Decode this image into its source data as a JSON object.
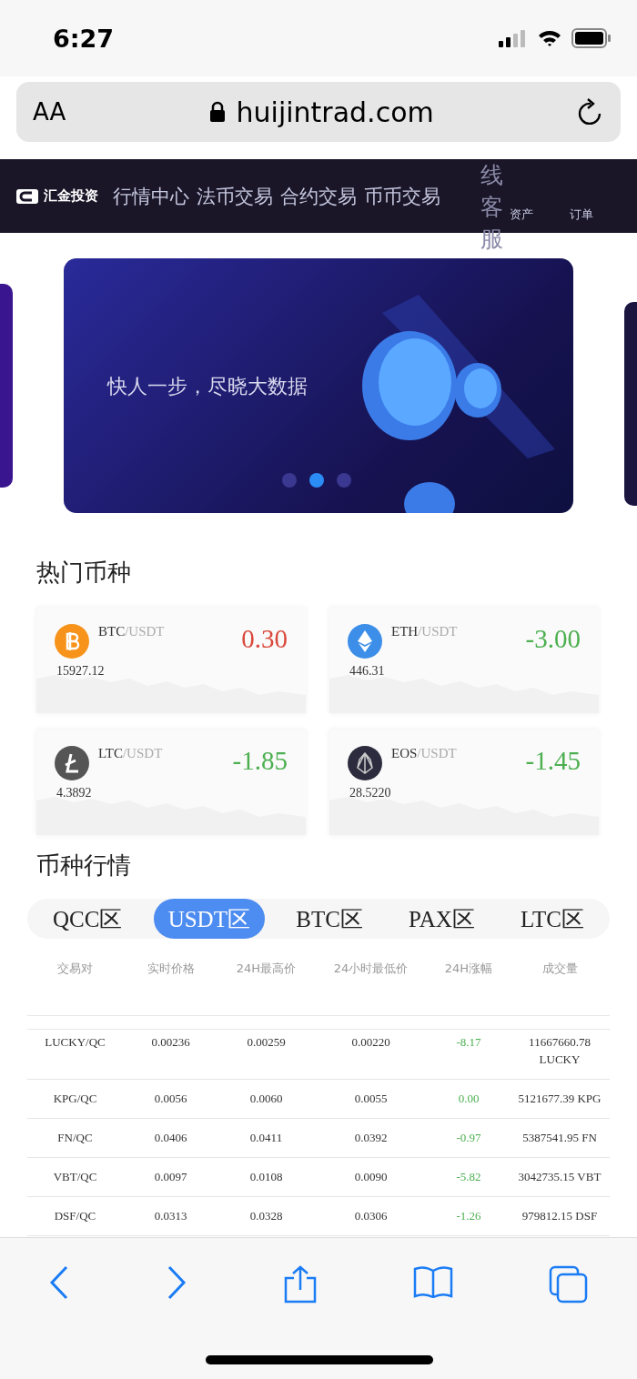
{
  "status_bar": {
    "time": "6:27"
  },
  "url_bar": {
    "text_size": "AA",
    "url": "huijintrad.com"
  },
  "nav": {
    "logo": "汇金投资",
    "items": [
      "行情中心",
      "法币交易",
      "合约交易",
      "币币交易"
    ],
    "service": "线客服",
    "right_items": [
      "资产",
      "订单"
    ]
  },
  "banner": {
    "caption": "快人一步，尽晓大数据",
    "dots": [
      {
        "selected": false
      },
      {
        "selected": true
      },
      {
        "selected": false
      }
    ]
  },
  "hot_title": "热门币种",
  "hot_coins": [
    {
      "kind": "btc",
      "base": "BTC",
      "quote": "/USDT",
      "price": "15927.12",
      "change": "0.30",
      "color": "#d9493c"
    },
    {
      "kind": "eth",
      "base": "ETH",
      "quote": "/USDT",
      "price": "446.31",
      "change": "-3.00",
      "color": "#4caf50"
    },
    {
      "kind": "ltc",
      "base": "LTC",
      "quote": "/USDT",
      "price": "4.3892",
      "change": "-1.85",
      "color": "#4caf50"
    },
    {
      "kind": "eos",
      "base": "EOS",
      "quote": "/USDT",
      "price": "28.5220",
      "change": "-1.45",
      "color": "#4caf50"
    }
  ],
  "market_title": "币种行情",
  "market_tabs": [
    {
      "label": "QCC区",
      "selected": false
    },
    {
      "label": "USDT区",
      "selected": true
    },
    {
      "label": "BTC区",
      "selected": false
    },
    {
      "label": "PAX区",
      "selected": false
    },
    {
      "label": "LTC区",
      "selected": false
    }
  ],
  "table": {
    "columns": [
      "交易对",
      "实时价格",
      "24H最高价",
      "24小时最低价",
      "24H涨幅",
      "成交量"
    ],
    "rows": [
      {
        "pair": "LUCKY/QC",
        "price": "0.00236",
        "high": "0.00259",
        "low": "0.00220",
        "change": "-8.17",
        "color": "#4caf50",
        "volume": "11667660.78 LUCKY"
      },
      {
        "pair": "KPG/QC",
        "price": "0.0056",
        "high": "0.0060",
        "low": "0.0055",
        "change": "0.00",
        "color": "#4caf50",
        "volume": "5121677.39 KPG"
      },
      {
        "pair": "FN/QC",
        "price": "0.0406",
        "high": "0.0411",
        "low": "0.0392",
        "change": "-0.97",
        "color": "#4caf50",
        "volume": "5387541.95 FN"
      },
      {
        "pair": "VBT/QC",
        "price": "0.0097",
        "high": "0.0108",
        "low": "0.0090",
        "change": "-5.82",
        "color": "#4caf50",
        "volume": "3042735.15 VBT"
      },
      {
        "pair": "DSF/QC",
        "price": "0.0313",
        "high": "0.0328",
        "low": "0.0306",
        "change": "-1.26",
        "color": "#4caf50",
        "volume": "979812.15 DSF"
      }
    ]
  }
}
